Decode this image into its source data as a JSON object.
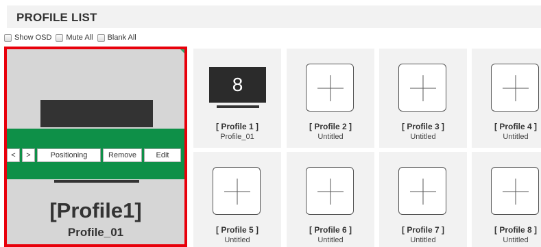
{
  "header": {
    "title": "PROFILE LIST"
  },
  "options": [
    {
      "label": "Show OSD"
    },
    {
      "label": "Mute All"
    },
    {
      "label": "Blank All"
    }
  ],
  "selected": {
    "title": "[Profile1]",
    "subtitle": "Profile_01",
    "buttons": {
      "prev": "<",
      "next": ">",
      "positioning": "Positioning",
      "remove": "Remove",
      "edit": "Edit"
    },
    "colors": {
      "border": "#e8000b",
      "accent": "#0e9048"
    }
  },
  "profiles": [
    {
      "name": "[ Profile 1 ]",
      "sub": "Profile_01",
      "thumb": "8"
    },
    {
      "name": "[ Profile 2 ]",
      "sub": "Untitled"
    },
    {
      "name": "[ Profile 3 ]",
      "sub": "Untitled"
    },
    {
      "name": "[ Profile 4 ]",
      "sub": "Untitled"
    },
    {
      "name": "[ Profile 5 ]",
      "sub": "Untitled"
    },
    {
      "name": "[ Profile 6 ]",
      "sub": "Untitled"
    },
    {
      "name": "[ Profile 7 ]",
      "sub": "Untitled"
    },
    {
      "name": "[ Profile 8 ]",
      "sub": "Untitled"
    }
  ]
}
